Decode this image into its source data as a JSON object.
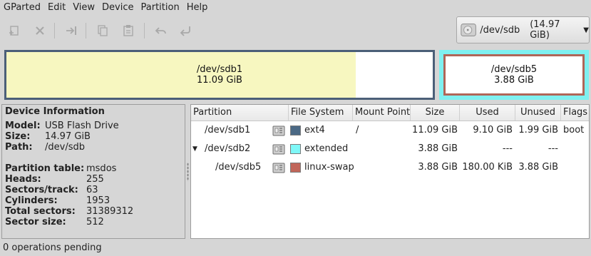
{
  "menu": [
    "GParted",
    "Edit",
    "View",
    "Device",
    "Partition",
    "Help"
  ],
  "toolbar": {
    "icons": [
      "new-partition-icon",
      "delete-icon",
      "resize-move-icon",
      "copy-icon",
      "paste-icon",
      "undo-icon",
      "apply-icon"
    ]
  },
  "device_selector": {
    "name": "/dev/sdb",
    "size": "(14.97 GiB)"
  },
  "partition_map": {
    "sdb1": {
      "name": "/dev/sdb1",
      "size": "11.09 GiB",
      "used_fraction": 0.82,
      "border_color": "#4b5f78",
      "used_color": "#f7f7c0"
    },
    "sdb5": {
      "name": "/dev/sdb5",
      "size": "3.88 GiB",
      "border_color": "#b06658"
    },
    "extended_color": "#7ff0f0"
  },
  "device_info": {
    "title": "Device Information",
    "model_label": "Model:",
    "model": "USB Flash Drive",
    "size_label": "Size:",
    "size": "14.97 GiB",
    "path_label": "Path:",
    "path": "/dev/sdb",
    "ptable_label": "Partition table:",
    "ptable": "msdos",
    "heads_label": "Heads:",
    "heads": "255",
    "sectors_track_label": "Sectors/track:",
    "sectors_track": "63",
    "cylinders_label": "Cylinders:",
    "cylinders": "1953",
    "total_sectors_label": "Total sectors:",
    "total_sectors": "31389312",
    "sector_size_label": "Sector size:",
    "sector_size": "512"
  },
  "table": {
    "headers": [
      "Partition",
      "File System",
      "Mount Point",
      "Size",
      "Used",
      "Unused",
      "Flags"
    ],
    "rows": [
      {
        "partition": "/dev/sdb1",
        "fs": "ext4",
        "fs_color": "#4b6985",
        "mount": "/",
        "size": "11.09 GiB",
        "used": "9.10 GiB",
        "unused": "1.99 GiB",
        "flags": "boot"
      },
      {
        "partition": "/dev/sdb2",
        "fs": "extended",
        "fs_color": "#7ff8f8",
        "mount": "",
        "size": "3.88 GiB",
        "used": "---",
        "unused": "---",
        "flags": ""
      },
      {
        "partition": "/dev/sdb5",
        "fs": "linux-swap",
        "fs_color": "#c1665a",
        "mount": "",
        "size": "3.88 GiB",
        "used": "180.00 KiB",
        "unused": "3.88 GiB",
        "flags": ""
      }
    ]
  },
  "status": "0 operations pending"
}
